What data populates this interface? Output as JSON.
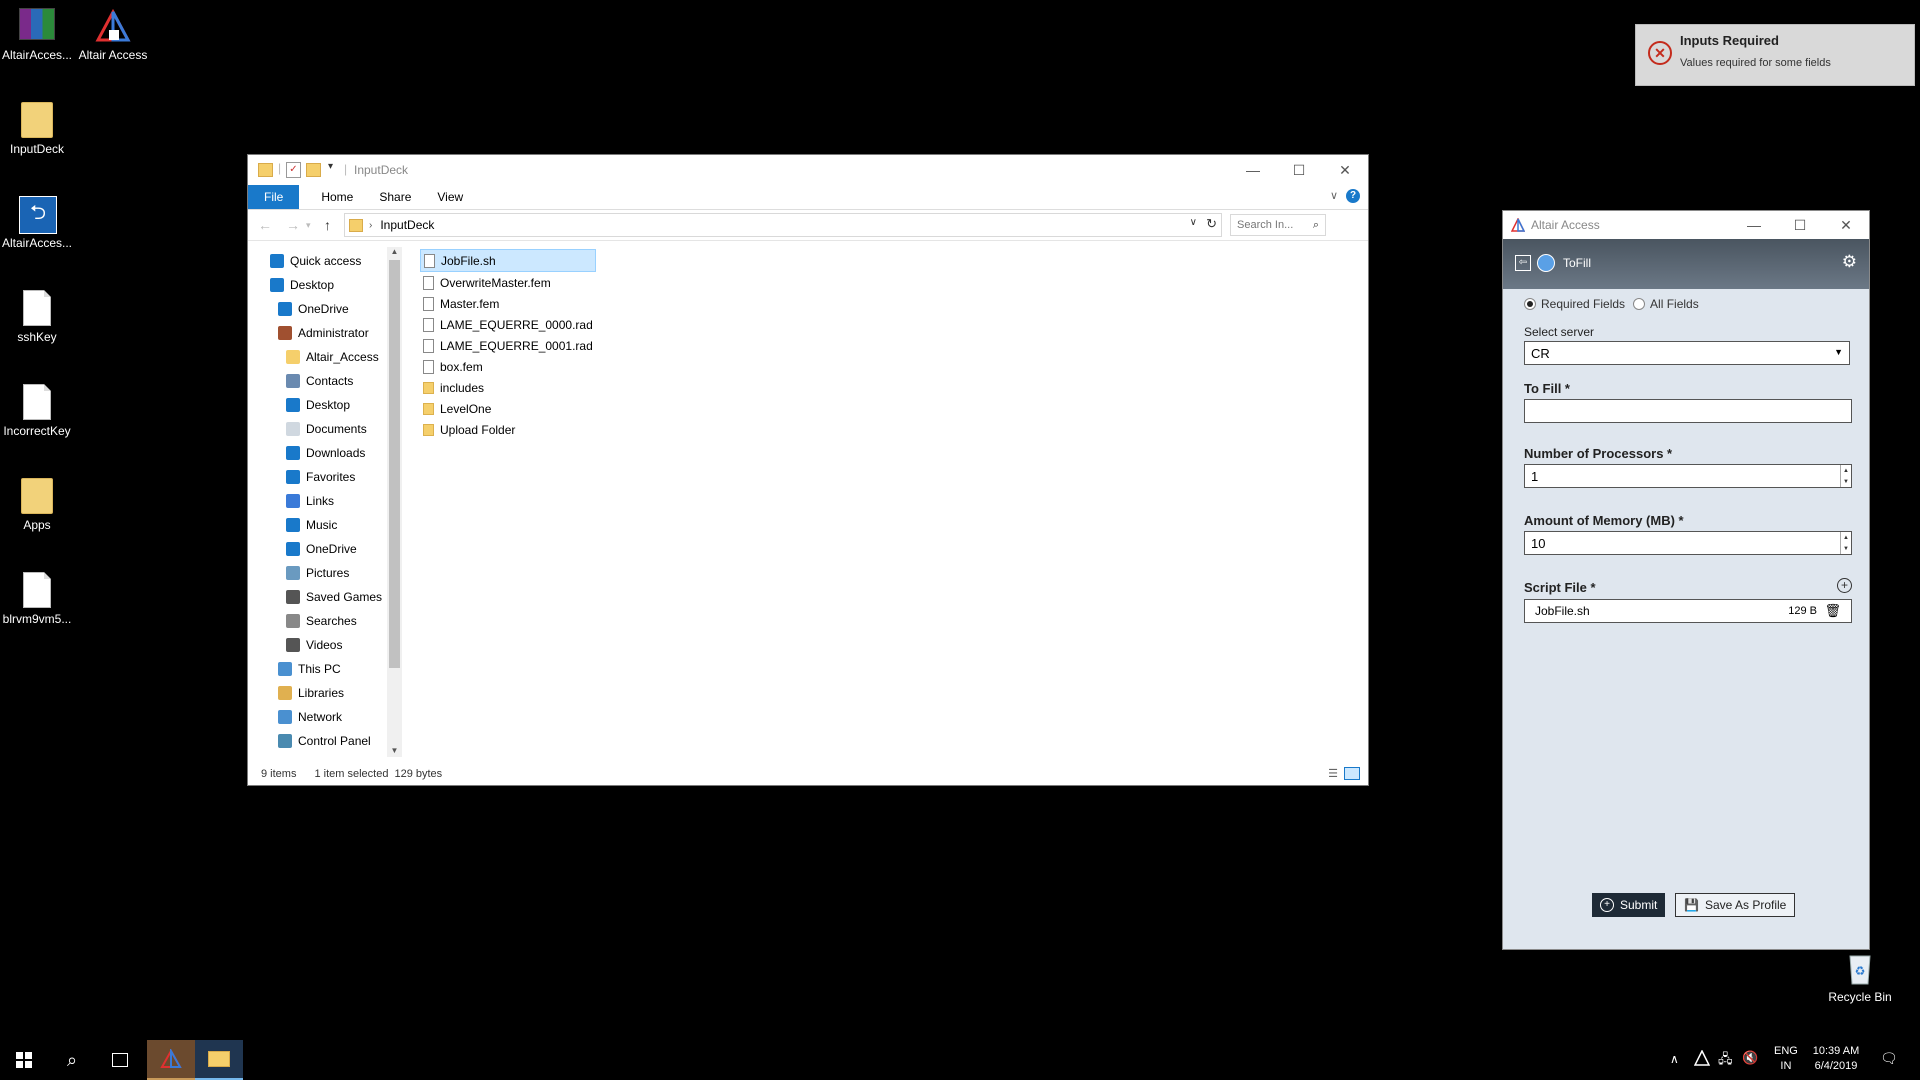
{
  "desktop": {
    "icons": [
      {
        "label": "AltairAcces...",
        "icon": "winrar-archive-icon"
      },
      {
        "label": "Altair Access",
        "icon": "altair-triangle-icon"
      },
      {
        "label": "InputDeck",
        "icon": "folder-icon"
      },
      {
        "label": "AltairAcces...",
        "icon": "installer-icon"
      },
      {
        "label": "sshKey",
        "icon": "file-icon"
      },
      {
        "label": "IncorrectKey",
        "icon": "file-icon"
      },
      {
        "label": "Apps",
        "icon": "folder-icon"
      },
      {
        "label": "blrvm9vm5...",
        "icon": "file-icon"
      },
      {
        "label": "Recycle Bin",
        "icon": "recycle-bin-icon"
      }
    ]
  },
  "toast": {
    "title": "Inputs Required",
    "message": "Values required for some fields",
    "icon": "error-circle-icon"
  },
  "explorer": {
    "title": "InputDeck",
    "tabs": [
      "File",
      "Home",
      "Share",
      "View"
    ],
    "address": "InputDeck",
    "search_placeholder": "Search In...",
    "nav": [
      {
        "label": "Quick access",
        "icon": "star-icon",
        "indent": 0
      },
      {
        "label": "Desktop",
        "icon": "desktop-icon",
        "indent": 0
      },
      {
        "label": "OneDrive",
        "icon": "cloud-icon",
        "indent": 1
      },
      {
        "label": "Administrator",
        "icon": "user-icon",
        "indent": 1
      },
      {
        "label": "Altair_Access",
        "icon": "folder-icon",
        "indent": 2
      },
      {
        "label": "Contacts",
        "icon": "contacts-icon",
        "indent": 2
      },
      {
        "label": "Desktop",
        "icon": "desktop-icon",
        "indent": 2
      },
      {
        "label": "Documents",
        "icon": "documents-icon",
        "indent": 2
      },
      {
        "label": "Downloads",
        "icon": "download-icon",
        "indent": 2
      },
      {
        "label": "Favorites",
        "icon": "star-icon",
        "indent": 2
      },
      {
        "label": "Links",
        "icon": "link-icon",
        "indent": 2
      },
      {
        "label": "Music",
        "icon": "music-icon",
        "indent": 2
      },
      {
        "label": "OneDrive",
        "icon": "cloud-icon",
        "indent": 2
      },
      {
        "label": "Pictures",
        "icon": "pictures-icon",
        "indent": 2
      },
      {
        "label": "Saved Games",
        "icon": "games-icon",
        "indent": 2
      },
      {
        "label": "Searches",
        "icon": "search-icon",
        "indent": 2
      },
      {
        "label": "Videos",
        "icon": "video-icon",
        "indent": 2
      },
      {
        "label": "This PC",
        "icon": "computer-icon",
        "indent": 1
      },
      {
        "label": "Libraries",
        "icon": "library-icon",
        "indent": 1
      },
      {
        "label": "Network",
        "icon": "network-icon",
        "indent": 1
      },
      {
        "label": "Control Panel",
        "icon": "control-panel-icon",
        "indent": 1
      }
    ],
    "files": [
      {
        "name": "JobFile.sh",
        "type": "file",
        "selected": true
      },
      {
        "name": "OverwriteMaster.fem",
        "type": "file"
      },
      {
        "name": "Master.fem",
        "type": "file"
      },
      {
        "name": "LAME_EQUERRE_0000.rad",
        "type": "file"
      },
      {
        "name": "LAME_EQUERRE_0001.rad",
        "type": "file"
      },
      {
        "name": "box.fem",
        "type": "file"
      },
      {
        "name": "includes",
        "type": "folder"
      },
      {
        "name": "LevelOne",
        "type": "folder"
      },
      {
        "name": "Upload Folder",
        "type": "folder"
      }
    ],
    "status": {
      "count": "9 items",
      "selected": "1 item selected",
      "size": "129 bytes"
    }
  },
  "altair": {
    "title": "Altair Access",
    "header": "ToFill",
    "radio_required": "Required Fields",
    "radio_all": "All Fields",
    "server_label": "Select server",
    "server_value": "CR",
    "tofill_label": "To Fill *",
    "tofill_value": "",
    "procs_label": "Number of Processors *",
    "procs_value": "1",
    "memory_label": "Amount of Memory (MB) *",
    "memory_value": "10",
    "script_label": "Script File *",
    "script_file": "JobFile.sh",
    "script_size": "129 B",
    "submit": "Submit",
    "save_profile": "Save As Profile"
  },
  "taskbar": {
    "lang": "ENG",
    "region": "IN",
    "time": "10:39 AM",
    "date": "6/4/2019"
  }
}
